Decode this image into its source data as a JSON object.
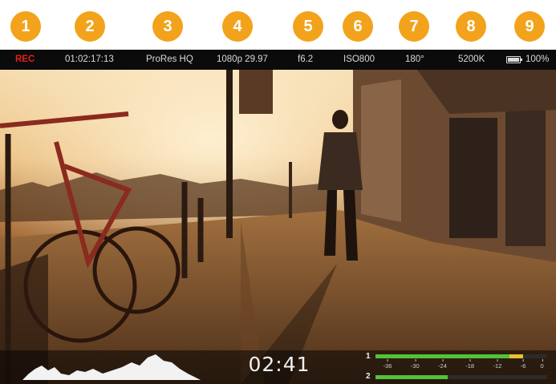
{
  "callouts": [
    "1",
    "2",
    "3",
    "4",
    "5",
    "6",
    "7",
    "8",
    "9"
  ],
  "status": {
    "record": "REC",
    "timecode": "01:02:17:13",
    "codec": "ProRes HQ",
    "format": "1080p 29.97",
    "aperture": "f6.2",
    "iso": "ISO800",
    "shutter": "180°",
    "white_balance": "5200K",
    "battery_level": 1.0,
    "battery_text": "100%"
  },
  "colors": {
    "callout": "#f2a31b",
    "record": "#e0201b",
    "meter_green": "#52c23a",
    "meter_yellow": "#e9c22e"
  },
  "storage": {
    "remaining_time": "02:41"
  },
  "audio": {
    "channels": [
      {
        "label": "1",
        "level": 0.78,
        "peak_yellow": 0.08
      },
      {
        "label": "2",
        "level": 0.42,
        "peak_yellow": 0
      }
    ],
    "scale": [
      "-36",
      "-30",
      "-24",
      "-18",
      "-12",
      "-6",
      "0"
    ]
  },
  "histogram": {
    "icon": "histogram-icon"
  }
}
